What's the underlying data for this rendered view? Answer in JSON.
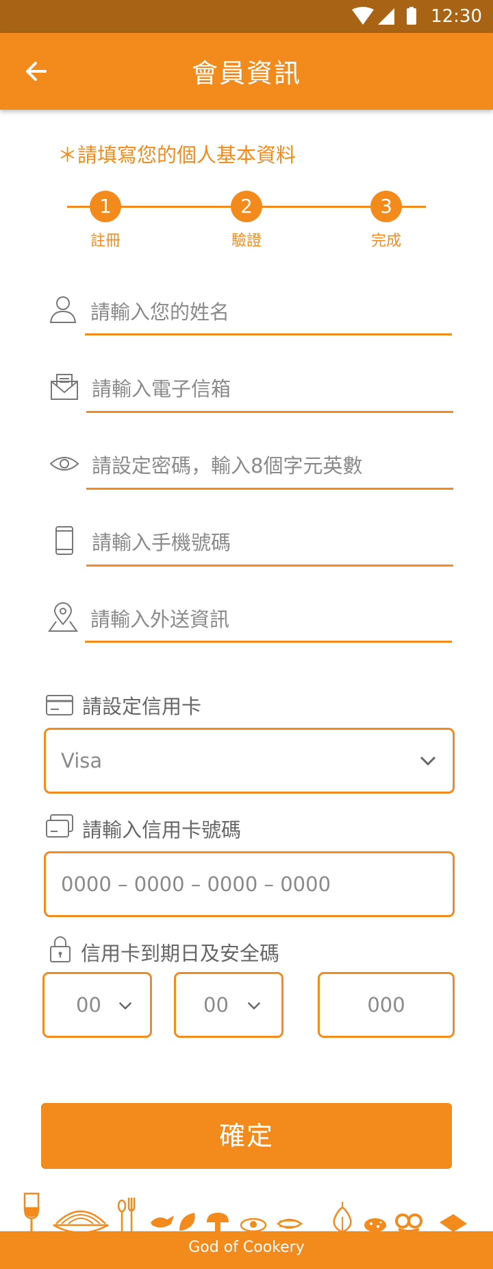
{
  "status_bar": {
    "time": "12:30"
  },
  "app_bar": {
    "title": "會員資訊"
  },
  "required_note": "＊請填寫您的個人基本資料",
  "steps": [
    {
      "number": "1",
      "label": "註冊"
    },
    {
      "number": "2",
      "label": "驗證"
    },
    {
      "number": "3",
      "label": "完成"
    }
  ],
  "fields": {
    "name": {
      "placeholder": "請輸入您的姓名"
    },
    "email": {
      "placeholder": "請輸入電子信箱"
    },
    "password": {
      "placeholder": "請設定密碼，輸入8個字元英數"
    },
    "phone": {
      "placeholder": "請輸入手機號碼"
    },
    "delivery": {
      "placeholder": "請輸入外送資訊"
    }
  },
  "credit_card": {
    "type_label": "請設定信用卡",
    "type_selected": "Visa",
    "number_label": "請輸入信用卡號碼",
    "number_placeholder": "0000 – 0000 – 0000 – 0000",
    "expiry_label": "信用卡到期日及安全碼",
    "month_selected": "00",
    "year_selected": "00",
    "cvv_placeholder": "000"
  },
  "confirm_label": "確定",
  "footer": {
    "brand": "God of Cookery"
  },
  "colors": {
    "primary": "#f28a1c",
    "status_bar": "#a86414"
  }
}
